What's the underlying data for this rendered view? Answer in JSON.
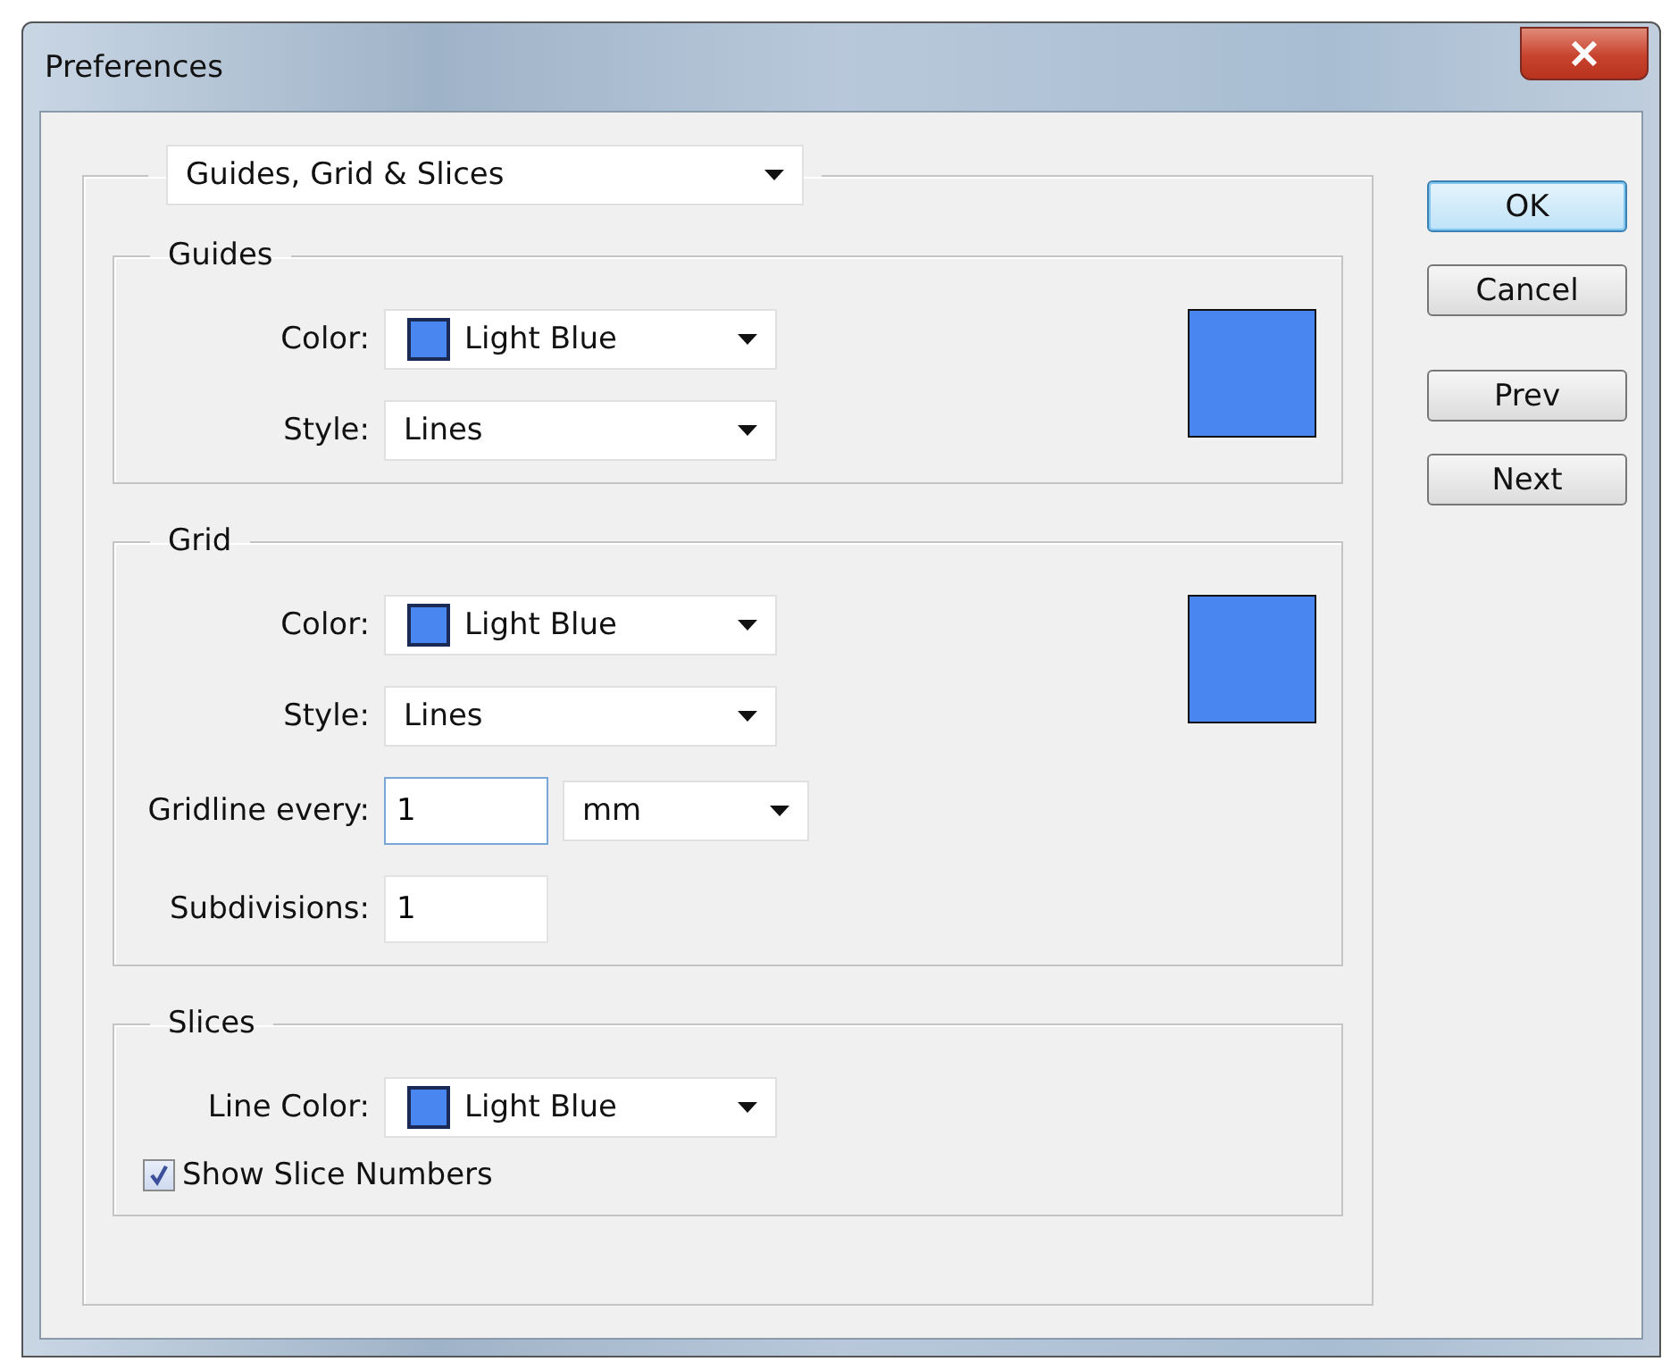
{
  "window": {
    "title": "Preferences"
  },
  "section_dropdown": {
    "value": "Guides, Grid & Slices"
  },
  "groups": [
    {
      "title": "Guides",
      "color": "#4a86f0",
      "rows": [
        {
          "kind": "color",
          "label": "Color:",
          "value": "Light Blue",
          "color": "#4a86f0"
        },
        {
          "kind": "select",
          "label": "Style:",
          "value": "Lines"
        }
      ]
    },
    {
      "title": "Grid",
      "color": "#4a86f0",
      "rows": [
        {
          "kind": "color",
          "label": "Color:",
          "value": "Light Blue",
          "color": "#4a86f0"
        },
        {
          "kind": "select",
          "label": "Style:",
          "value": "Lines"
        },
        {
          "kind": "text",
          "label": "Gridline every:",
          "value": "1",
          "focused": true,
          "unit": "mm"
        },
        {
          "kind": "text",
          "label": "Subdivisions:",
          "value": "1",
          "focused": false
        }
      ]
    },
    {
      "title": "Slices",
      "rows": [
        {
          "kind": "color",
          "label": "Line Color:",
          "value": "Light Blue",
          "color": "#4a86f0"
        },
        {
          "kind": "checkbox",
          "label": "Show Slice Numbers",
          "checked": true
        }
      ]
    }
  ],
  "buttons": [
    {
      "label": "OK",
      "default": true
    },
    {
      "label": "Cancel",
      "default": false
    },
    {
      "label": "Prev",
      "default": false
    },
    {
      "label": "Next",
      "default": false
    }
  ]
}
